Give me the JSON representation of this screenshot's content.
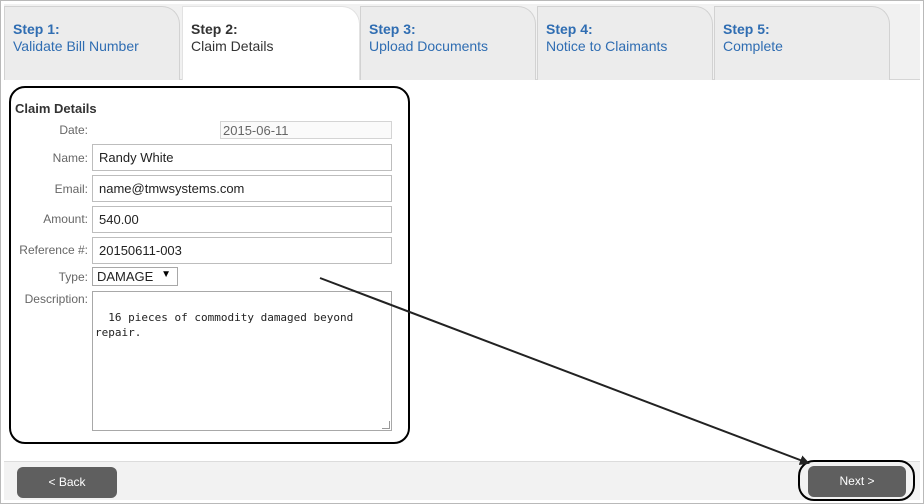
{
  "wizard": {
    "steps": [
      {
        "num": "Step 1:",
        "title": "Validate Bill Number"
      },
      {
        "num": "Step 2:",
        "title": "Claim Details"
      },
      {
        "num": "Step 3:",
        "title": "Upload Documents"
      },
      {
        "num": "Step 4:",
        "title": "Notice to Claimants"
      },
      {
        "num": "Step 5:",
        "title": "Complete"
      }
    ],
    "active_step": 2
  },
  "claim": {
    "section_title": "Claim Details",
    "date_label": "Date:",
    "date_value": "2015-06-11",
    "name_label": "Name:",
    "name_value": "Randy White",
    "email_label": "Email:",
    "email_value": "name@tmwsystems.com",
    "amount_label": "Amount:",
    "amount_value": "540.00",
    "reference_label": "Reference #:",
    "reference_value": "20150611-003",
    "type_label": "Type:",
    "type_value": "DAMAGE",
    "description_label": "Description:",
    "description_value": "16 pieces of commodity damaged beyond\nrepair."
  },
  "footer": {
    "back_label": "< Back",
    "next_label": "Next >"
  },
  "colors": {
    "step_link": "#2f6db2",
    "button_bg": "#5f5f5f",
    "annotation": "#000000"
  }
}
